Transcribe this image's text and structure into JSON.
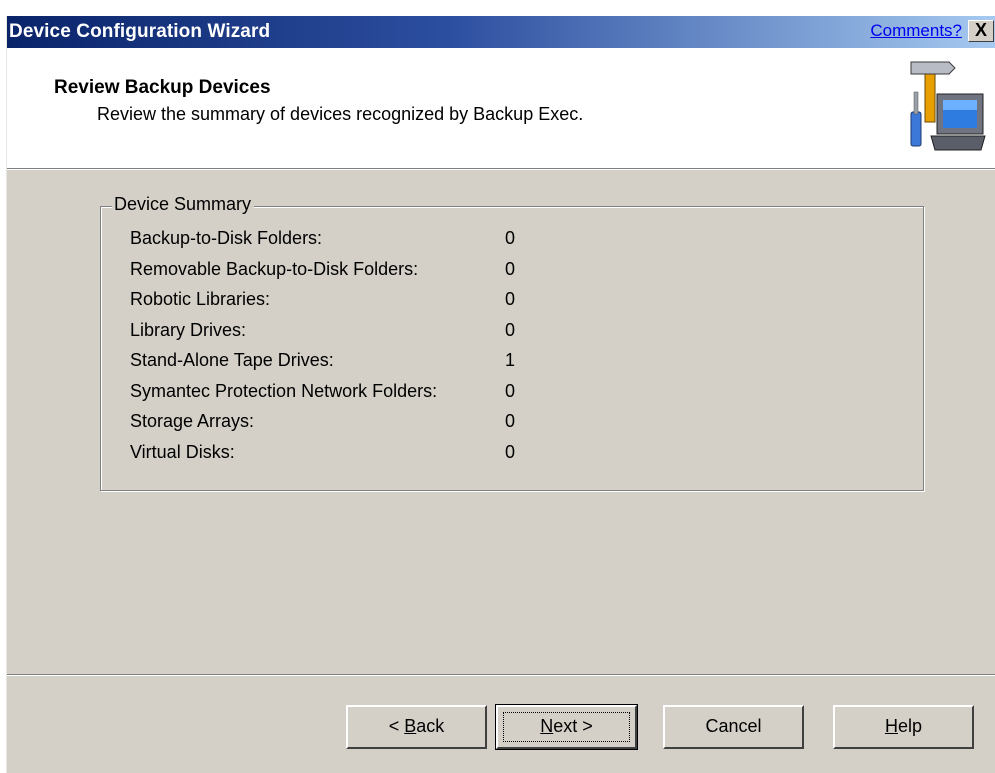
{
  "window": {
    "title": "Device Configuration Wizard",
    "comments_link": "Comments?",
    "close_glyph": "X"
  },
  "header": {
    "title": "Review Backup Devices",
    "subtitle": "Review the summary of devices recognized by Backup Exec.",
    "icon": "wrench-hammer-computer-icon"
  },
  "summary": {
    "legend": "Device Summary",
    "rows": [
      {
        "label": "Backup-to-Disk Folders:",
        "value": "0"
      },
      {
        "label": "Removable Backup-to-Disk Folders:",
        "value": "0"
      },
      {
        "label": "Robotic Libraries:",
        "value": "0"
      },
      {
        "label": "Library Drives:",
        "value": "0"
      },
      {
        "label": "Stand-Alone Tape Drives:",
        "value": "1"
      },
      {
        "label": "Symantec Protection Network Folders:",
        "value": "0"
      },
      {
        "label": "Storage Arrays:",
        "value": "0"
      },
      {
        "label": "Virtual Disks:",
        "value": "0"
      }
    ]
  },
  "buttons": {
    "back": {
      "pre": "< ",
      "mnemonic": "B",
      "post": "ack"
    },
    "next": {
      "pre": "",
      "mnemonic": "N",
      "post": "ext >"
    },
    "cancel": {
      "label": "Cancel"
    },
    "help": {
      "pre": "",
      "mnemonic": "H",
      "post": "elp"
    }
  },
  "colors": {
    "title_gradient_start": "#0a246a",
    "title_gradient_end": "#a6caf0",
    "dialog_face": "#d4d0c8",
    "link": "#0000ee"
  }
}
